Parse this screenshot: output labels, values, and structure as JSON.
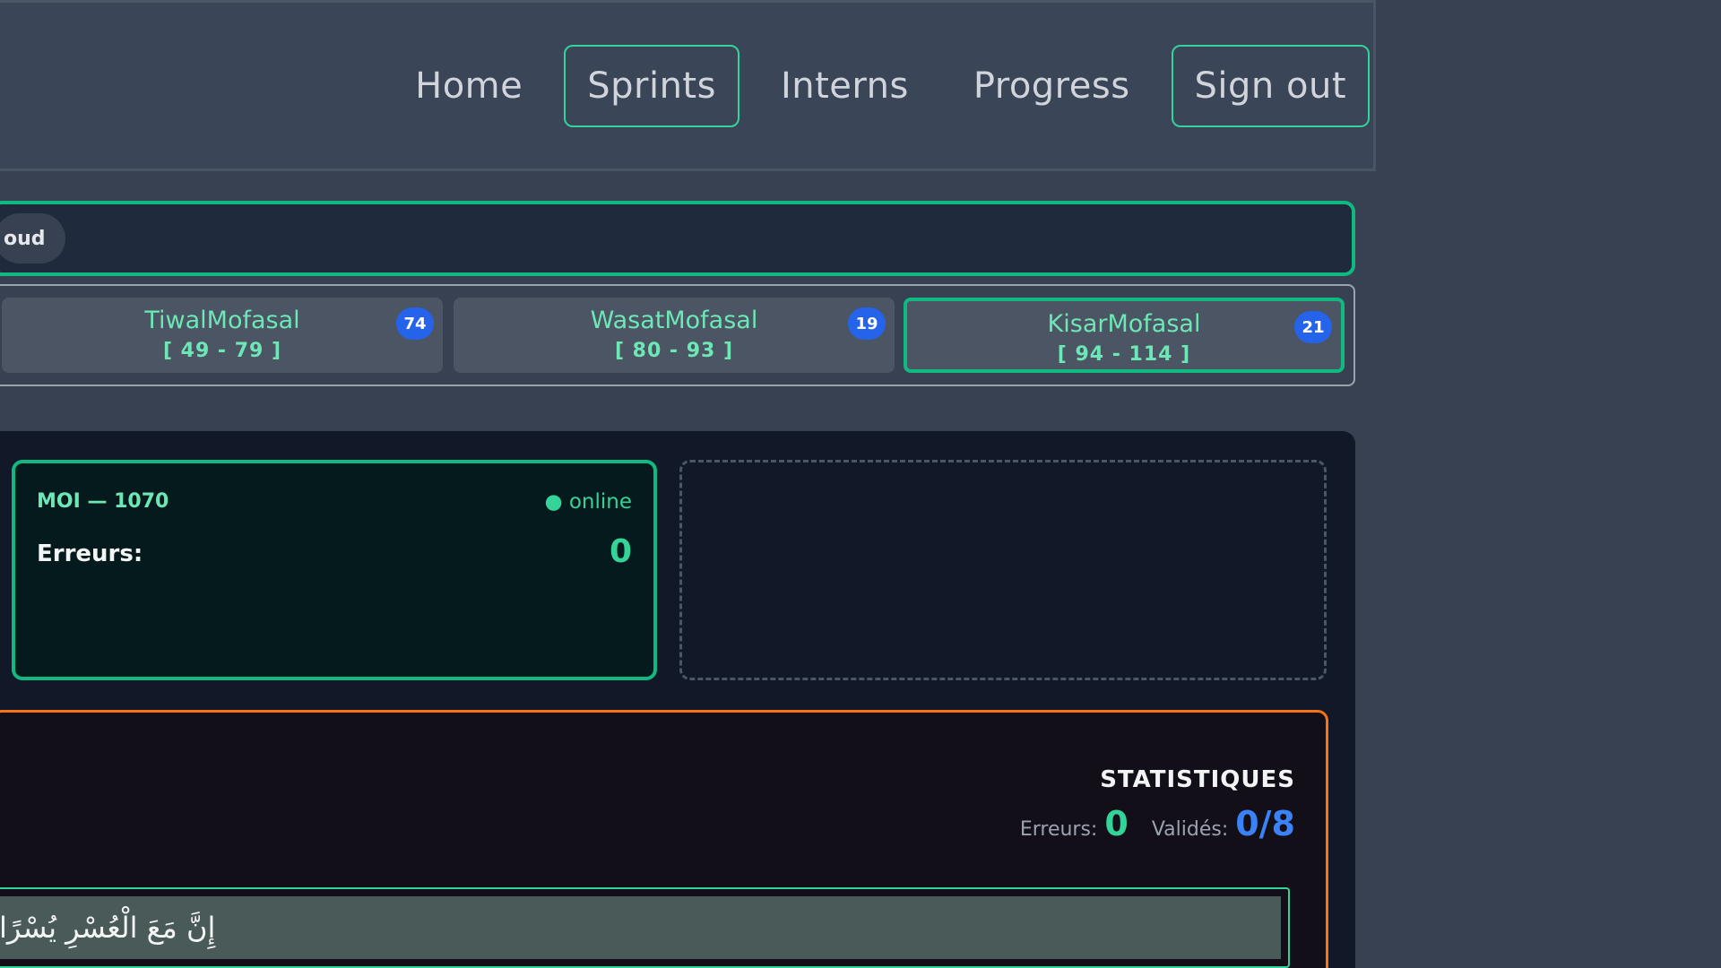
{
  "nav": {
    "items": [
      {
        "label": "Home",
        "boxed": false
      },
      {
        "label": "Sprints",
        "boxed": true
      },
      {
        "label": "Interns",
        "boxed": false
      },
      {
        "label": "Progress",
        "boxed": false
      },
      {
        "label": "Sign out",
        "boxed": true
      }
    ]
  },
  "pill": {
    "label": "oud"
  },
  "tabs": [
    {
      "name": "TiwalMofasal",
      "range": "[ 49 - 79 ]",
      "badge": "74",
      "active": false
    },
    {
      "name": "WasatMofasal",
      "range": "[ 80 - 93 ]",
      "badge": "19",
      "active": false
    },
    {
      "name": "KisarMofasal",
      "range": "[ 94 - 114 ]",
      "badge": "21",
      "active": true
    }
  ],
  "me_card": {
    "title": "MOI — 1070",
    "status": "● online",
    "errors_label": "Erreurs:",
    "errors_value": "0"
  },
  "stats": {
    "title": "STATISTIQUES",
    "errors_label": "Erreurs:",
    "errors_value": "0",
    "valid_label": "Validés:",
    "valid_value": "0/8"
  },
  "verse": {
    "text": "إِنَّ مَعَ الْعُسْرِ يُسْرًا"
  },
  "colors": {
    "accent": "#10b981",
    "badge": "#2563eb",
    "stats_border": "#f97316"
  }
}
